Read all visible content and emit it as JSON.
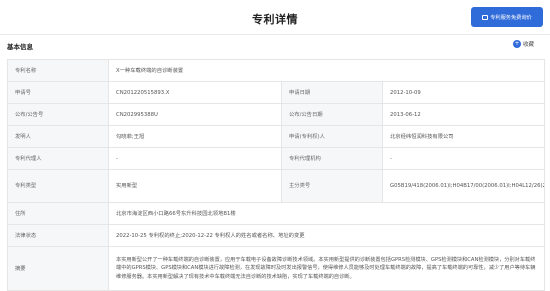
{
  "header": {
    "title": "专利详情",
    "consult_button": "专利服务免费询价"
  },
  "section": {
    "title": "基本信息",
    "favorite": "收藏"
  },
  "fields": {
    "patent_name_label": "专利名称",
    "patent_name": "X一种车载终端的自诊断装置",
    "app_no_label": "申请号",
    "app_no": "CN201220515893.X",
    "app_date_label": "申请日期",
    "app_date": "2012-10-09",
    "pub_no_label": "公布/公告号",
    "pub_no": "CN202995388U",
    "pub_date_label": "公布/公告日期",
    "pub_date": "2013-06-12",
    "inventor_label": "发明人",
    "inventor": "勾晓菲;王旭",
    "applicant_label": "申请(专利权)人",
    "applicant": "北京经纬恒润科技有限公司",
    "agent_label": "专利代理人",
    "agent": "-",
    "agency_label": "专利代理机构",
    "agency": "-",
    "type_label": "专利类型",
    "type": "实用新型",
    "ipc_label": "主分类号",
    "ipc": "G05B19/418(2006.01)I;H04B17/00(2006.01)I;H04L12/26(2006.01)I",
    "address_label": "住所",
    "address": "北京市海淀区西小口路66号东升科技园北领地B1楼",
    "legal_label": "法律状态",
    "legal": "2022-10-25 专利权的终止;2020-12-22 专利权人的姓名或者名称、地址的变更",
    "abstract_label": "摘要",
    "abstract": "本实用新型公开了一种车载终端的自诊断装置，应用于车载电子设备故障诊断技术领域。本实用新型提供的诊断装置包括GPRS检测模块、GPS检测模块和CAN检测模块，分别对车载终端中的GPRS模块、GPS模块和CAN模块进行故障检测，在发现故障时及时发出报警信号，使得维修人员能够及时处理车载终端的故障，提高了车载终端的可靠性，减少了用户等待车辆维修服务器。本实用新型解决了现有技术中车载终端无法自诊断的技术缺陷，实现了车载终端的自诊断。"
  }
}
